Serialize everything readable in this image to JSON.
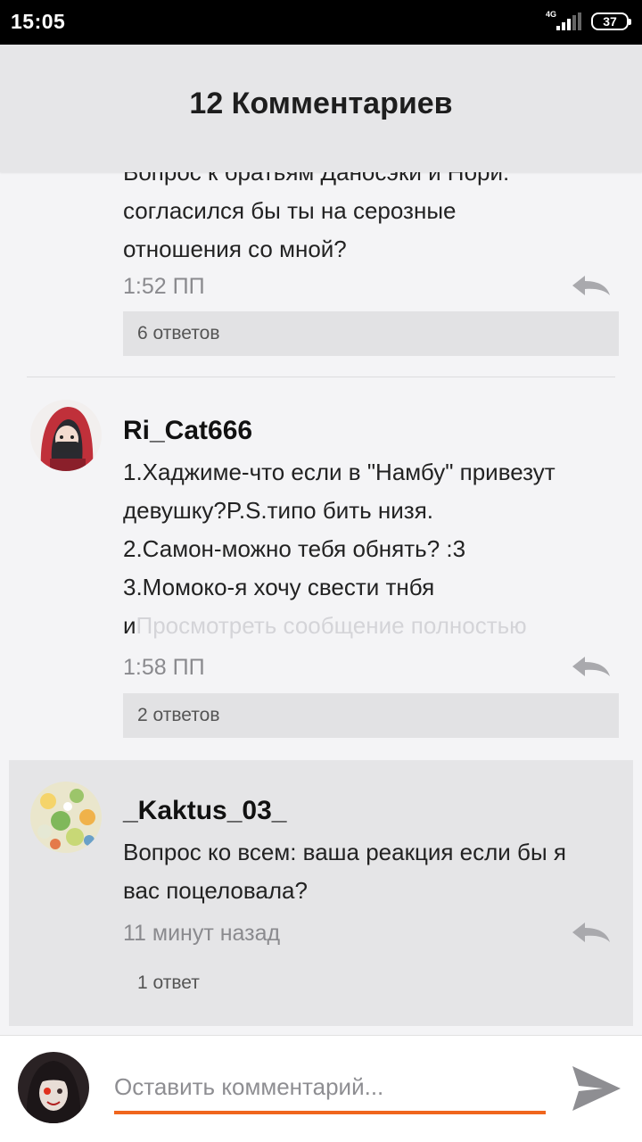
{
  "status_bar": {
    "time": "15:05",
    "network": "4G",
    "battery": "37"
  },
  "header": {
    "title": "12 Комментариев"
  },
  "comments": [
    {
      "text_lines": [
        "Вопрос к братьям Даносэки и Нори:",
        "согласился бы ты на серозные",
        "отношения со мной?"
      ],
      "time": "1:52 ПП",
      "replies": "6 ответов"
    },
    {
      "username": "Ri_Cat666",
      "avatar": "hooded-girl-avatar",
      "text_lines": [
        "1.Хаджиме-что если в \"Намбу\" привезут",
        "девушку?P.S.типо бить низя.",
        "2.Самон-можно тебя обнять? :3",
        "3.Момоко-я хочу свести тнбя"
      ],
      "last_line_start": "и",
      "more_link": "Просмотреть сообщение полностью",
      "time": "1:58 ПП",
      "replies": "2 ответов"
    },
    {
      "username": "_Kaktus_03_",
      "avatar": "flowers-avatar",
      "text_lines": [
        "Вопрос ко всем: ваша реакция если бы я",
        "вас поцеловала?"
      ],
      "time": "11 минут назад",
      "replies": "1 ответ"
    }
  ],
  "composer": {
    "placeholder": "Оставить комментарий...",
    "avatar": "masked-user-avatar",
    "send_icon": "send-icon"
  },
  "colors": {
    "accent": "#f0661e",
    "header_bg": "#e6e6e8",
    "highlight_bg": "#e5e5e7"
  }
}
